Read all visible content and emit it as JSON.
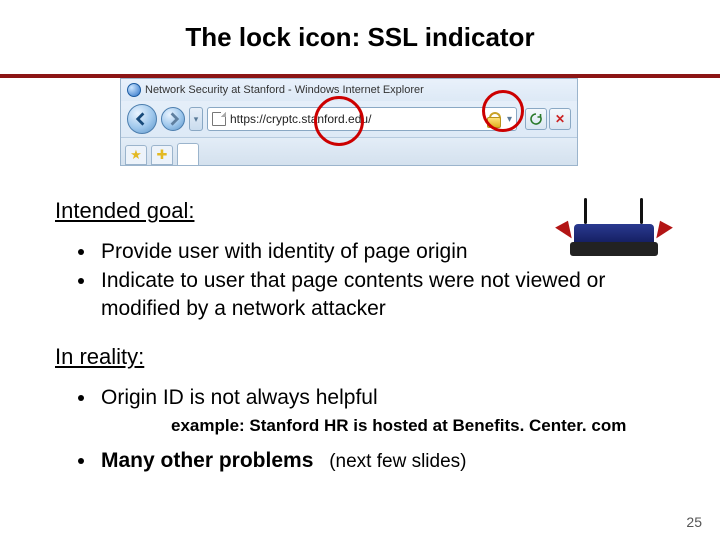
{
  "title": "The lock icon:    SSL indicator",
  "browser": {
    "window_title": "Network Security at Stanford - Windows Internet Explorer",
    "url": "https://cryptc.stanford.edu/",
    "tab_label": ""
  },
  "section1_heading": "Intended goal:",
  "section1_bullets": [
    "Provide user with identity of page origin",
    "Indicate to user that page contents were not viewed or modified by a network attacker"
  ],
  "section2_heading": "In reality:",
  "section2_item1": "Origin ID is not always helpful",
  "section2_item1_sub": "example:   Stanford HR is hosted at  Benefits. Center. com",
  "section2_item2": "Many other problems",
  "section2_item2_note": "(next few slides)",
  "page_number": "25"
}
